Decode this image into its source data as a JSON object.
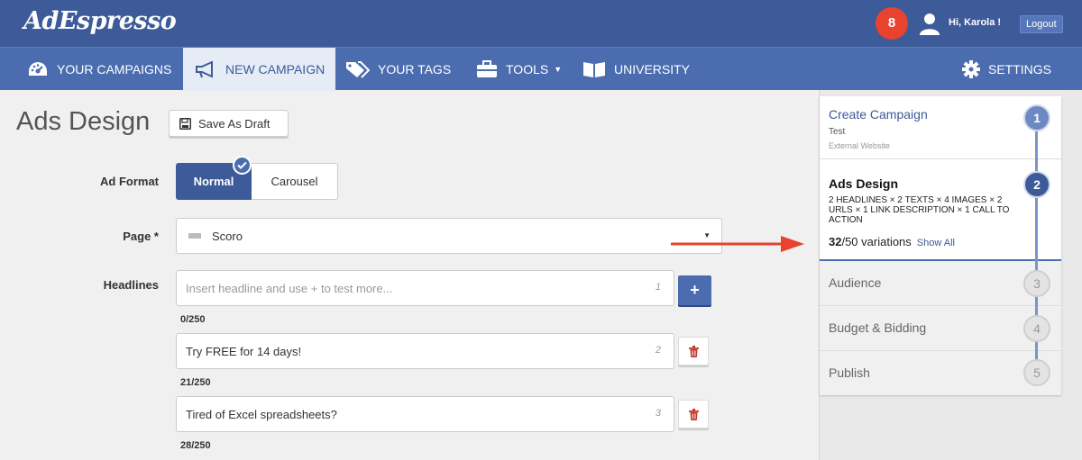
{
  "app": {
    "logo": "AdEspresso"
  },
  "topbar": {
    "notifications": "8",
    "greeting": "Hi, Karola !",
    "logout": "Logout"
  },
  "nav": {
    "items": [
      {
        "label": "YOUR CAMPAIGNS",
        "icon": "dashboard-icon"
      },
      {
        "label": "NEW CAMPAIGN",
        "icon": "megaphone-icon"
      },
      {
        "label": "YOUR TAGS",
        "icon": "tags-icon"
      },
      {
        "label": "TOOLS",
        "icon": "toolbox-icon"
      },
      {
        "label": "UNIVERSITY",
        "icon": "book-icon"
      }
    ],
    "settings": {
      "label": "SETTINGS",
      "icon": "gear-icon"
    }
  },
  "page": {
    "title": "Ads Design",
    "save_draft": "Save As Draft"
  },
  "form": {
    "ad_format_label": "Ad Format",
    "ad_format_options": [
      "Normal",
      "Carousel"
    ],
    "page_label": "Page *",
    "page_value": "Scoro",
    "headlines_label": "Headlines",
    "headlines": [
      {
        "placeholder": "Insert headline and use + to test more...",
        "value": "",
        "index": "1",
        "counter": "0/250"
      },
      {
        "placeholder": "",
        "value": "Try FREE for 14 days!",
        "index": "2",
        "counter": "21/250"
      },
      {
        "placeholder": "",
        "value": "Tired of Excel spreadsheets?",
        "index": "3",
        "counter": "28/250"
      }
    ]
  },
  "steps": [
    {
      "number": "1",
      "title": "Create Campaign",
      "sub": "Test",
      "sub2": "External Website"
    },
    {
      "number": "2",
      "title": "Ads Design",
      "desc": "2 HEADLINES × 2 TEXTS × 4 IMAGES × 2 URLS × 1 LINK DESCRIPTION × 1 CALL TO ACTION",
      "variations_count": "32",
      "variations_rest": "/50 variations",
      "show_all": "Show All"
    },
    {
      "number": "3",
      "title": "Audience"
    },
    {
      "number": "4",
      "title": "Budget & Bidding"
    },
    {
      "number": "5",
      "title": "Publish"
    }
  ],
  "colors": {
    "brand": "#3d5a99",
    "nav": "#4b6db0",
    "alert": "#e8432f",
    "delete": "#c0392b"
  }
}
